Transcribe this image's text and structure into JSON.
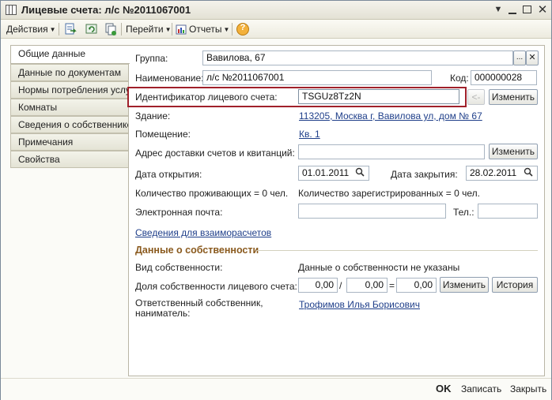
{
  "window": {
    "title": "Лицевые счета: л/с №2011067001"
  },
  "toolbar": {
    "actions_label": "Действия",
    "goto_label": "Перейти",
    "reports_label": "Отчеты",
    "help_label": "?"
  },
  "tabs": [
    {
      "label": "Общие данные",
      "active": true
    },
    {
      "label": "Данные по документам",
      "active": false
    },
    {
      "label": "Нормы потребления услуг",
      "active": false
    },
    {
      "label": "Комнаты",
      "active": false
    },
    {
      "label": "Сведения о собственнике",
      "active": false
    },
    {
      "label": "Примечания",
      "active": false
    },
    {
      "label": "Свойства",
      "active": false
    }
  ],
  "form": {
    "group_label": "Группа:",
    "group_value": "Вавилова, 67",
    "name_label": "Наименование:",
    "name_value": "л/с №2011067001",
    "code_label": "Код:",
    "code_value": "000000028",
    "account_id_label": "Идентификатор лицевого счета:",
    "account_id_value": "TSGUz8Tz2N",
    "back_arrow": "<-",
    "change_label": "Изменить",
    "building_label": "Здание:",
    "building_value": "113205, Москва г, Вавилова ул, дом № 67",
    "premises_label": "Помещение:",
    "premises_value": "Кв. 1",
    "delivery_label": "Адрес доставки счетов и квитанций:",
    "delivery_value": "",
    "open_date_label": "Дата открытия:",
    "open_date_value": "01.01.2011",
    "close_date_label": "Дата закрытия:",
    "close_date_value": "28.02.2011",
    "residents_text": "Количество проживающих = 0 чел.",
    "registered_text": "Количество зарегистрированных = 0 чел.",
    "email_label": "Электронная почта:",
    "email_value": "",
    "phone_label": "Тел.:",
    "phone_value": "",
    "settlements_link": "Сведения для взаиморасчетов"
  },
  "ownership": {
    "section_title": "Данные о собственности",
    "type_label": "Вид собственности:",
    "type_value": "Данные о собственности не указаны",
    "share_label": "Доля собственности лицевого счета:",
    "share_num": "0,00",
    "share_slash": "/",
    "share_den": "0,00",
    "share_eq": "=",
    "share_result": "0,00",
    "change_label": "Изменить",
    "history_label": "История",
    "owner_label_line1": "Ответственный собственник,",
    "owner_label_line2": "наниматель:",
    "owner_value": "Трофимов Илья Борисович"
  },
  "footer": {
    "ok_label": "OK",
    "save_label": "Записать",
    "close_label": "Закрыть"
  },
  "colors": {
    "highlight": "#a0202a",
    "link": "#1f3f8a",
    "section_title": "#8a5a1e"
  }
}
